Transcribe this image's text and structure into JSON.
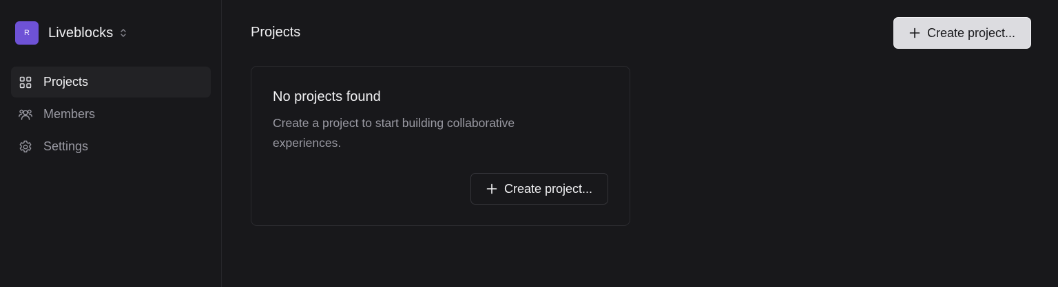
{
  "sidebar": {
    "org": {
      "avatar_letter": "R",
      "name": "Liveblocks",
      "avatar_color": "#6e52d6"
    },
    "items": [
      {
        "label": "Projects",
        "icon": "grid-icon",
        "active": true
      },
      {
        "label": "Members",
        "icon": "users-icon",
        "active": false
      },
      {
        "label": "Settings",
        "icon": "gear-icon",
        "active": false
      }
    ]
  },
  "header": {
    "title": "Projects",
    "create_button_label": "Create project..."
  },
  "empty_state": {
    "title": "No projects found",
    "description": "Create a project to start building collaborative experiences.",
    "button_label": "Create project..."
  },
  "colors": {
    "background": "#18181b",
    "accent": "#6e52d6",
    "primary_button": "#dcdce0"
  }
}
